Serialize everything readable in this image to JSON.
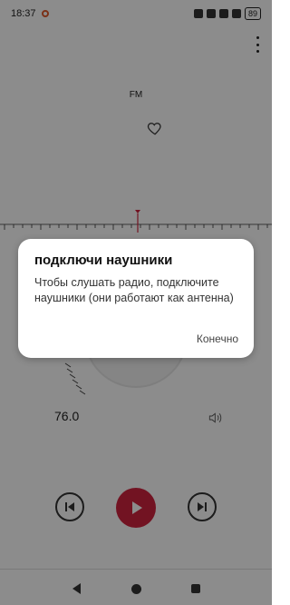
{
  "status_bar": {
    "time": "18:37",
    "battery": "89"
  },
  "screen": {
    "band_label": "FM",
    "frequency": "76.0"
  },
  "dialog": {
    "title": "подключи наушники",
    "message": "Чтобы слушать радио, подключите наушники (они работают как антенна)",
    "confirm_label": "Конечно"
  },
  "colors": {
    "accent": "#d0243f",
    "scrim": "rgba(0,0,0,0.45)"
  },
  "icons": {
    "favorite": "heart-icon",
    "previous": "skip-previous-icon",
    "play": "play-icon",
    "next": "skip-next-icon",
    "volume": "volume-icon",
    "menu": "more-vert-icon"
  }
}
